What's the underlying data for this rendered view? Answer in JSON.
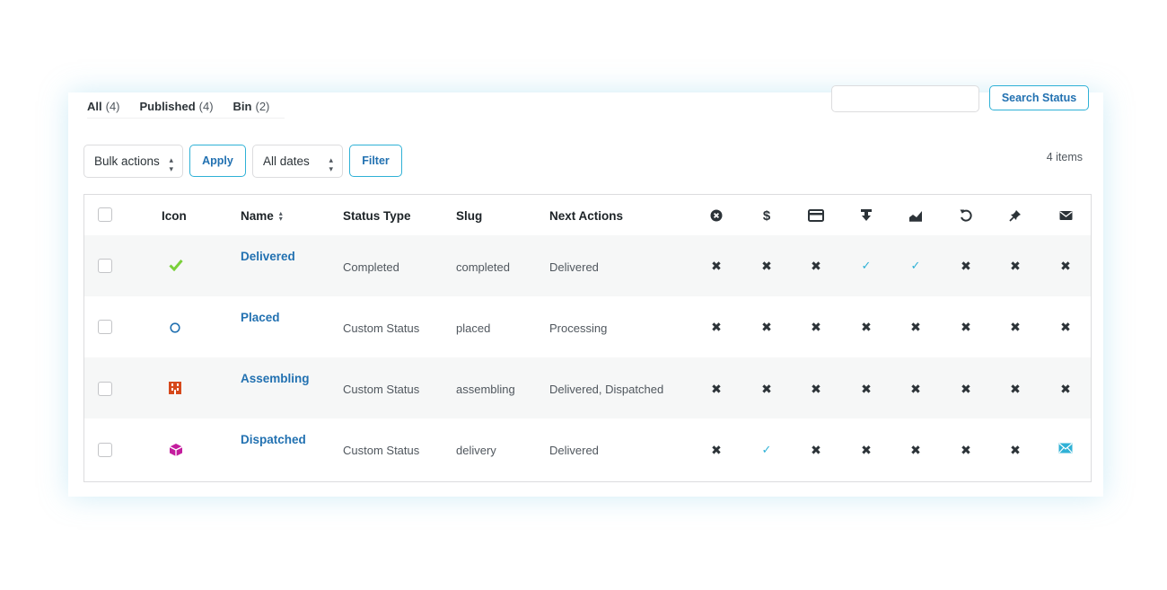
{
  "tabs": [
    {
      "label": "All",
      "count": "(4)"
    },
    {
      "label": "Published",
      "count": "(4)"
    },
    {
      "label": "Bin",
      "count": "(2)"
    }
  ],
  "search": {
    "button": "Search Status",
    "value": ""
  },
  "toolbar": {
    "bulk_actions": "Bulk actions",
    "apply": "Apply",
    "dates": "All dates",
    "filter": "Filter",
    "items_count": "4 items"
  },
  "table": {
    "headers": {
      "icon": "Icon",
      "name": "Name",
      "status_type": "Status Type",
      "slug": "Slug",
      "next_actions": "Next Actions"
    },
    "flag_columns": [
      "cancel-circle-icon",
      "dollar-icon",
      "credit-card-icon",
      "download-icon",
      "chart-area-icon",
      "undo-icon",
      "pin-icon",
      "email-icon"
    ],
    "rows": [
      {
        "name": "Delivered",
        "icon": "checkmark-icon",
        "icon_color": "#7ad03a",
        "status_type": "Completed",
        "slug": "completed",
        "next_actions": "Delivered",
        "flags": [
          "no",
          "no",
          "no",
          "yes",
          "yes",
          "no",
          "no",
          "no"
        ]
      },
      {
        "name": "Placed",
        "icon": "circle-icon",
        "icon_color": "#2271b1",
        "status_type": "Custom Status",
        "slug": "placed",
        "next_actions": "Processing",
        "flags": [
          "no",
          "no",
          "no",
          "no",
          "no",
          "no",
          "no",
          "no"
        ]
      },
      {
        "name": "Assembling",
        "icon": "building-icon",
        "icon_color": "#d6491c",
        "status_type": "Custom Status",
        "slug": "assembling",
        "next_actions": "Delivered, Dispatched",
        "flags": [
          "no",
          "no",
          "no",
          "no",
          "no",
          "no",
          "no",
          "no"
        ]
      },
      {
        "name": "Dispatched",
        "icon": "cube-icon",
        "icon_color": "#c41d9e",
        "status_type": "Custom Status",
        "slug": "delivery",
        "next_actions": "Delivered",
        "flags": [
          "no",
          "yes",
          "no",
          "no",
          "no",
          "no",
          "no",
          "email"
        ]
      }
    ]
  },
  "colors": {
    "accent": "#2271b1",
    "border_accent": "#2fb1d6",
    "yes": "#2fb1d6"
  }
}
